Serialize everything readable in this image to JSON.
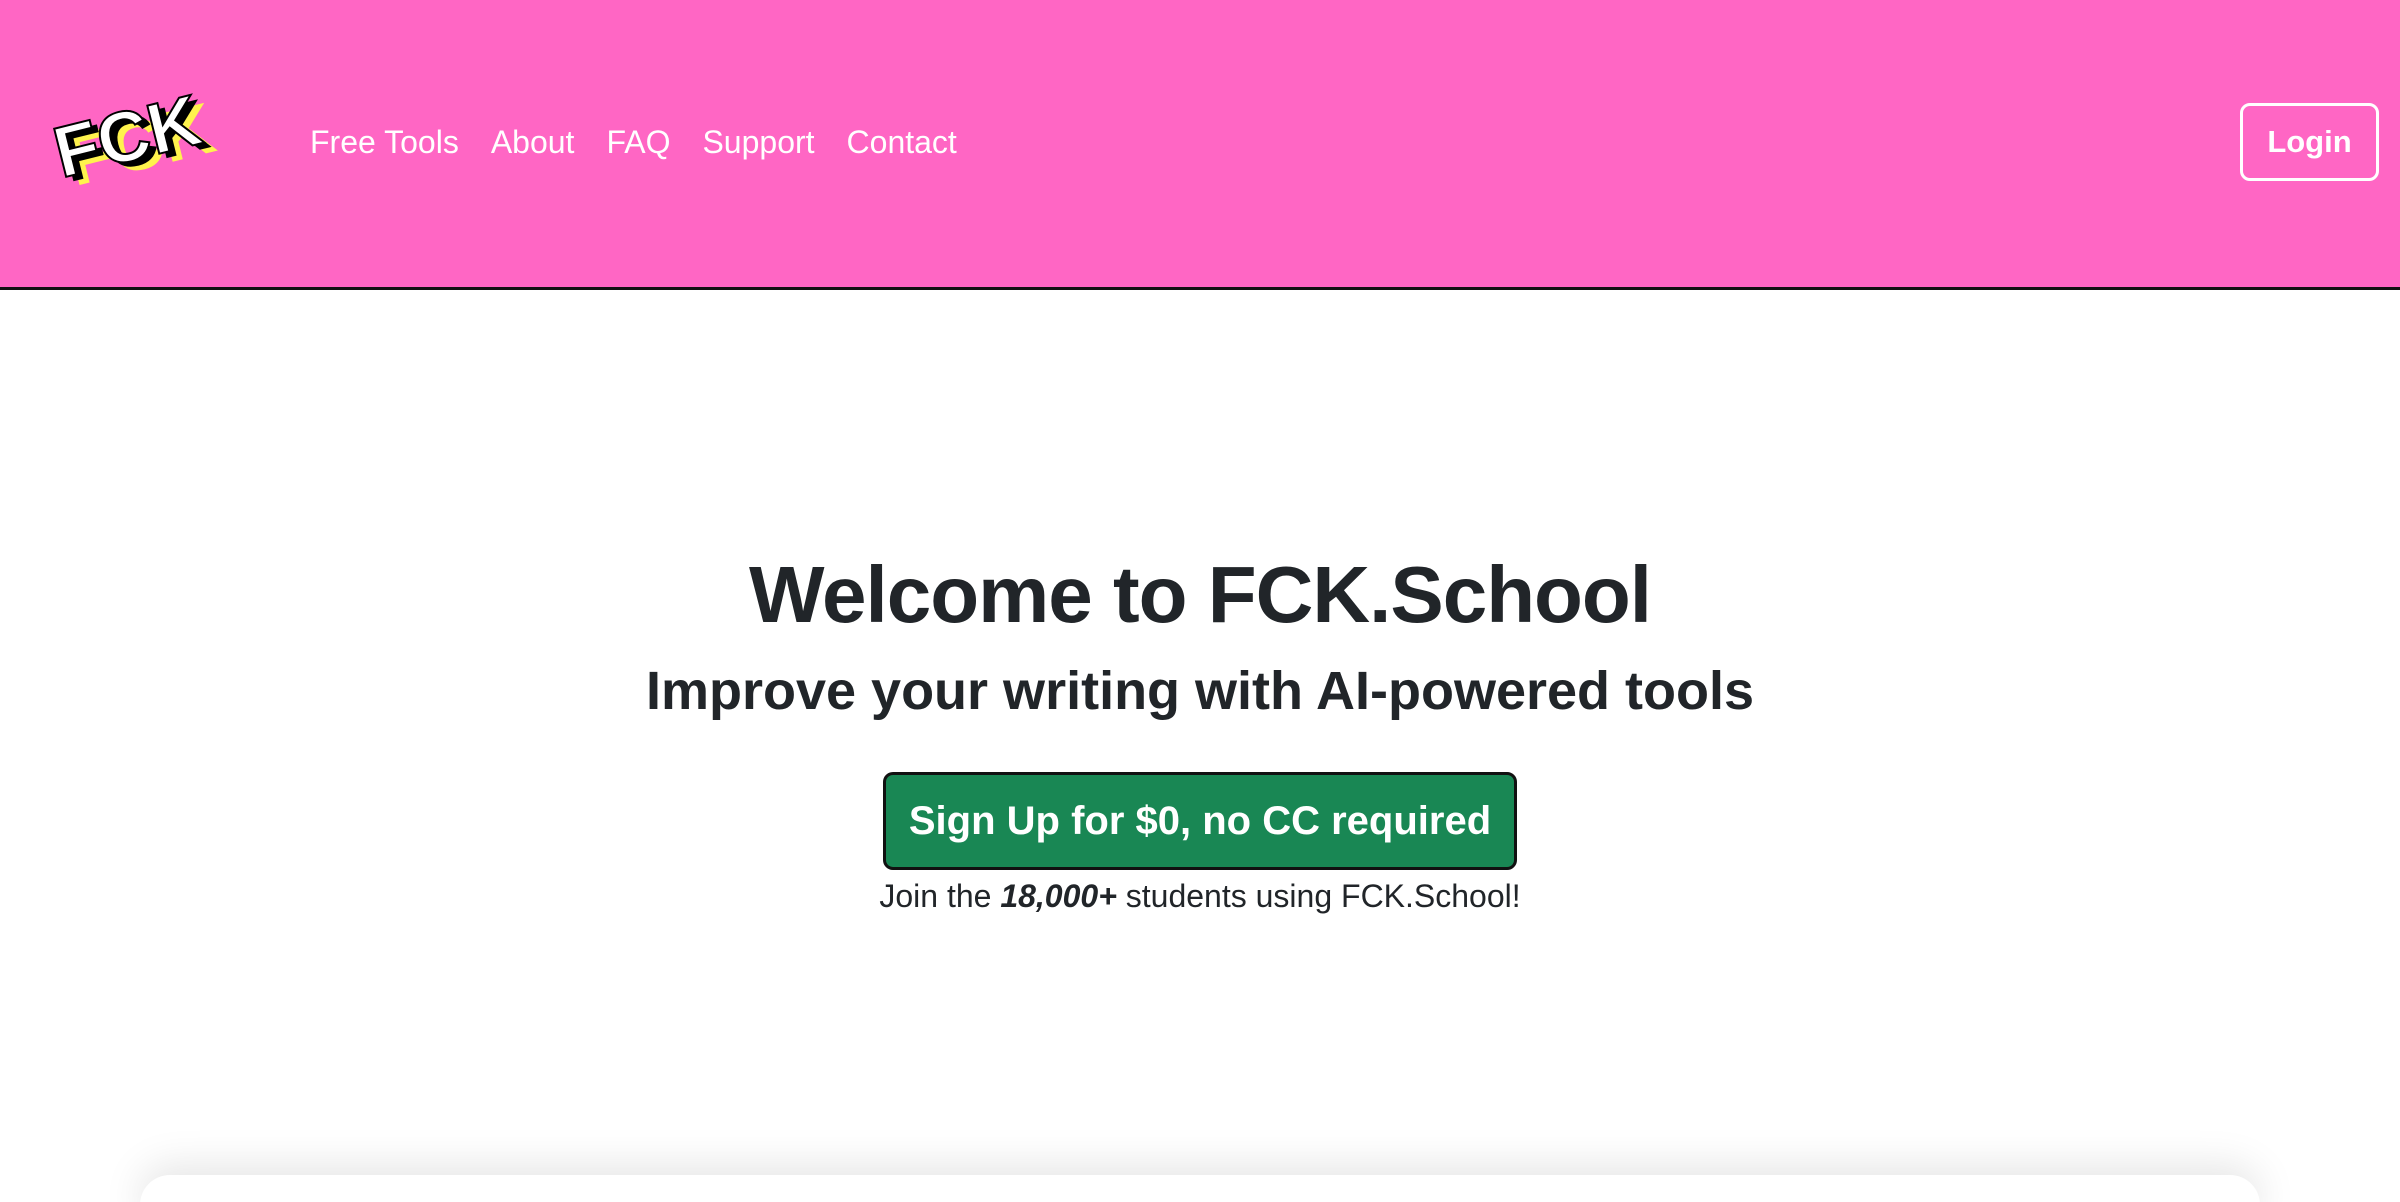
{
  "colors": {
    "navbar_bg": "#ff66c4",
    "signup_bg": "#198754",
    "logo_yellow": "#fff34d"
  },
  "logo": {
    "text": "FCK"
  },
  "nav": {
    "items": [
      {
        "label": "Free Tools"
      },
      {
        "label": "About"
      },
      {
        "label": "FAQ"
      },
      {
        "label": "Support"
      },
      {
        "label": "Contact"
      }
    ],
    "login_label": "Login"
  },
  "hero": {
    "title": "Welcome to FCK.School",
    "subtitle": "Improve your writing with AI-powered tools",
    "signup_label": "Sign Up for $0, no CC required",
    "join_prefix": "Join the ",
    "join_count": "18,000+",
    "join_suffix": " students using FCK.School!"
  }
}
